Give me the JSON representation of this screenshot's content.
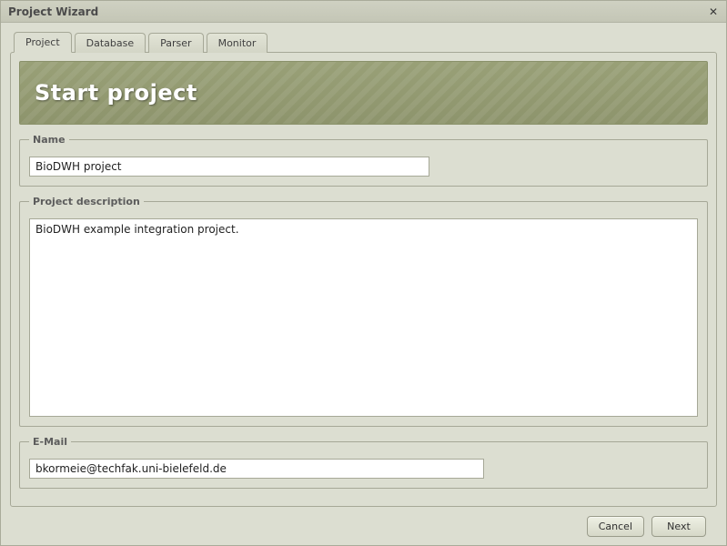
{
  "window": {
    "title": "Project Wizard"
  },
  "tabs": [
    {
      "label": "Project",
      "active": true
    },
    {
      "label": "Database",
      "active": false
    },
    {
      "label": "Parser",
      "active": false
    },
    {
      "label": "Monitor",
      "active": false
    }
  ],
  "banner": {
    "heading": "Start project"
  },
  "groups": {
    "name": {
      "legend": "Name",
      "value": "BioDWH project"
    },
    "description": {
      "legend": "Project description",
      "value": "BioDWH example integration project."
    },
    "email": {
      "legend": "E-Mail",
      "value": "bkormeie@techfak.uni-bielefeld.de"
    }
  },
  "buttons": {
    "cancel": "Cancel",
    "next": "Next"
  }
}
